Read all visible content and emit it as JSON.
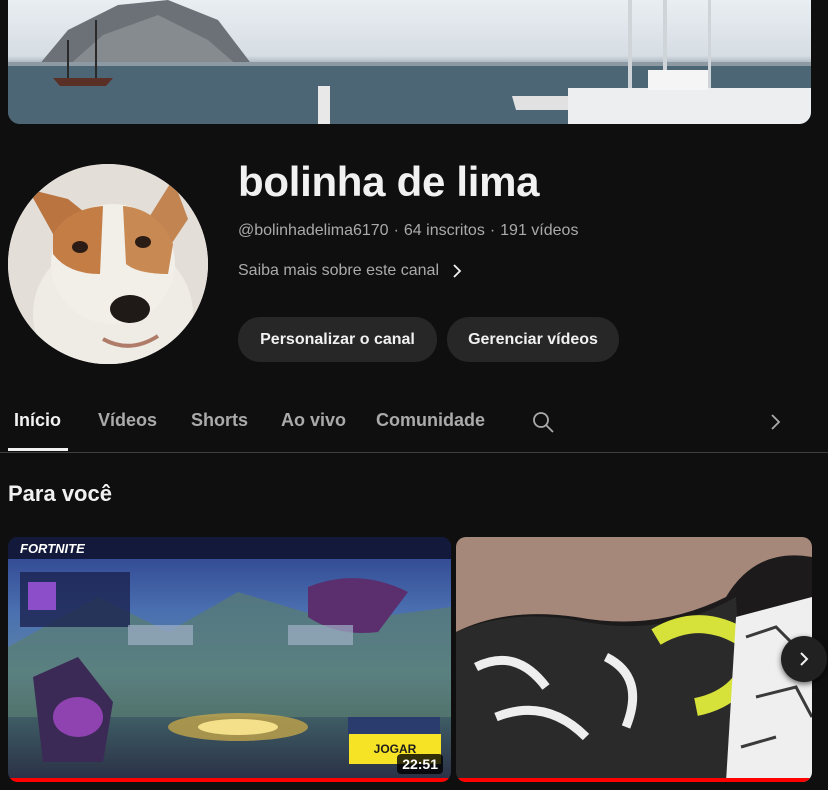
{
  "channel": {
    "name": "bolinha de lima",
    "handle": "@bolinhadelima6170",
    "subscribers": "64 inscritos",
    "videos_count": "191 vídeos",
    "separator": "·",
    "about_link": "Saiba mais sobre este canal"
  },
  "actions": {
    "customize_label": "Personalizar o canal",
    "manage_label": "Gerenciar vídeos"
  },
  "tabs": [
    {
      "label": "Início",
      "active": true
    },
    {
      "label": "Vídeos",
      "active": false
    },
    {
      "label": "Shorts",
      "active": false
    },
    {
      "label": "Ao vivo",
      "active": false
    },
    {
      "label": "Comunidade",
      "active": false
    }
  ],
  "section": {
    "title": "Para você"
  },
  "videos": [
    {
      "duration": "22:51",
      "overlay_logo": "FORTNITE",
      "overlay_button": "JOGAR",
      "watched_fraction": 1.0
    },
    {
      "duration": "",
      "watched_fraction": 1.0
    }
  ],
  "colors": {
    "background": "#0f0f0f",
    "pill": "#272727",
    "progress": "#ff0000",
    "secondary_text": "#aaaaaa"
  },
  "icons": [
    "search-icon",
    "chevron-right-icon"
  ]
}
